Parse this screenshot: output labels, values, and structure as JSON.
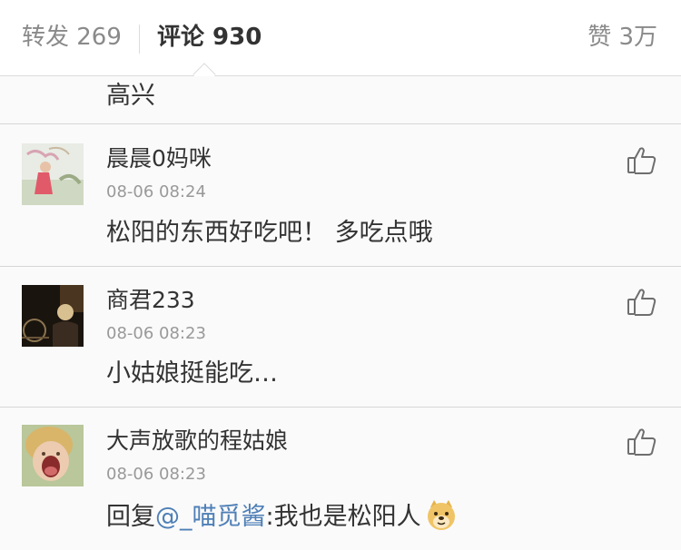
{
  "tabs": {
    "repost": "转发 269",
    "comments": "评论 930",
    "likes": "赞 3万"
  },
  "colors": {
    "mention": "#4e7fb7",
    "timestamp": "#999999",
    "background": "#f2f2f2"
  },
  "partial_comment": {
    "text": "高兴"
  },
  "comments": [
    {
      "name": "晨晨0妈咪",
      "time": "08-06 08:24",
      "text": "松阳的东西好吃吧！ 多吃点哦",
      "avatar": "avatar-girl-outdoors",
      "like_icon": "thumbs-up-icon"
    },
    {
      "name": "商君233",
      "time": "08-06 08:23",
      "text": "小姑娘挺能吃…",
      "avatar": "avatar-dark-night",
      "like_icon": "thumbs-up-icon"
    },
    {
      "name": "大声放歌的程姑娘",
      "time": "08-06 08:23",
      "reply_prefix": "回复",
      "mention": "@_喵觅酱",
      "text": ":我也是松阳人",
      "emoji": "doge-emoji",
      "avatar": "avatar-child-laughing",
      "like_icon": "thumbs-up-icon"
    }
  ]
}
